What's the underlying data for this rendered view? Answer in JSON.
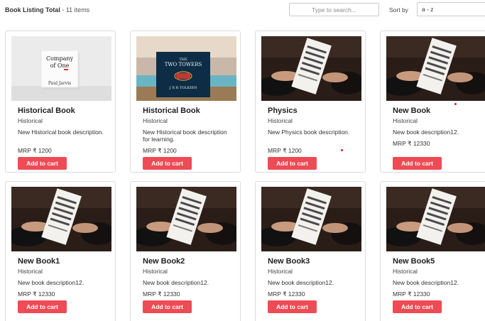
{
  "header": {
    "title": "Book Listing Total",
    "count_label": "- 11 items",
    "search_placeholder": "Type to search...",
    "sort_label": "Sort by",
    "sort_value": "a - z"
  },
  "accent_color": "#ee4b55",
  "books": [
    {
      "title": "Historical Book",
      "category": "Historical",
      "description": "New Historical book description.",
      "price": "MRP ₹ 1200",
      "button_label": "Add to cart",
      "cover": "company-of-one-cover",
      "cover_text": [
        "Company",
        "of One",
        "Paul Jarvis"
      ]
    },
    {
      "title": "Historical Book",
      "category": "Historical",
      "description": "New Historical book description for learning.",
      "price": "MRP ₹ 1200",
      "button_label": "Add to cart",
      "cover": "two-towers-cover",
      "cover_text": [
        "THE",
        "TWO TOWERS",
        "J R R TOLKIEN"
      ]
    },
    {
      "title": "Physics",
      "category": "Historical",
      "description": "New Physics book description.",
      "price": "MRP ₹ 1200",
      "button_label": "Add to cart",
      "cover": "essays-photo"
    },
    {
      "title": "New Book",
      "category": "Historical",
      "description": "New book description12.",
      "price": "MRP ₹ 12330",
      "button_label": "Add to cart",
      "cover": "essays-photo"
    },
    {
      "title": "New Book1",
      "category": "Historical",
      "description": "New book description12.",
      "price": "MRP ₹ 12330",
      "button_label": "Add to cart",
      "cover": "essays-photo"
    },
    {
      "title": "New Book2",
      "category": "Historical",
      "description": "New book description12.",
      "price": "MRP ₹ 12330",
      "button_label": "Add to cart",
      "cover": "essays-photo"
    },
    {
      "title": "New Book3",
      "category": "Historical",
      "description": "New book description12.",
      "price": "MRP ₹ 12330",
      "button_label": "Add to cart",
      "cover": "essays-photo"
    },
    {
      "title": "New Book5",
      "category": "Historical",
      "description": "New book description12.",
      "price": "MRP ₹ 12330",
      "button_label": "Add to cart",
      "cover": "essays-photo"
    }
  ]
}
